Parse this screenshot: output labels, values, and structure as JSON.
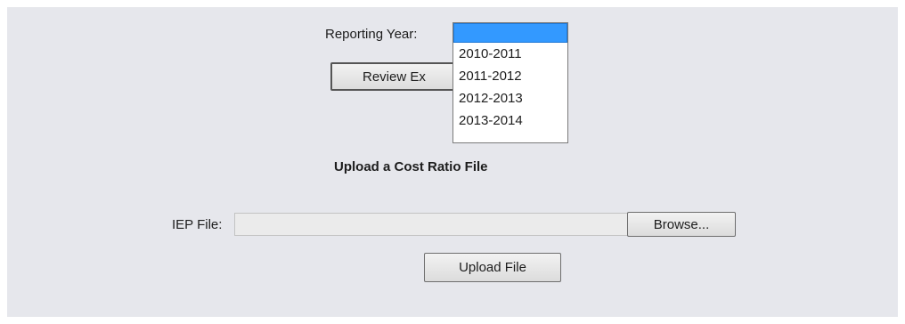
{
  "form": {
    "reporting_year_label": "Reporting Year:",
    "reporting_year_selected": "",
    "reporting_year_options": [
      "2010-2011",
      "2011-2012",
      "2012-2013",
      "2013-2014"
    ],
    "review_button_label": "Review Ex",
    "upload_heading": "Upload a Cost Ratio File",
    "iep_file_label": "IEP File:",
    "iep_file_value": "",
    "browse_button_label": "Browse...",
    "upload_button_label": "Upload File"
  },
  "colors": {
    "panel_bg": "#e6e7ec",
    "selected_highlight": "#3399ff"
  }
}
